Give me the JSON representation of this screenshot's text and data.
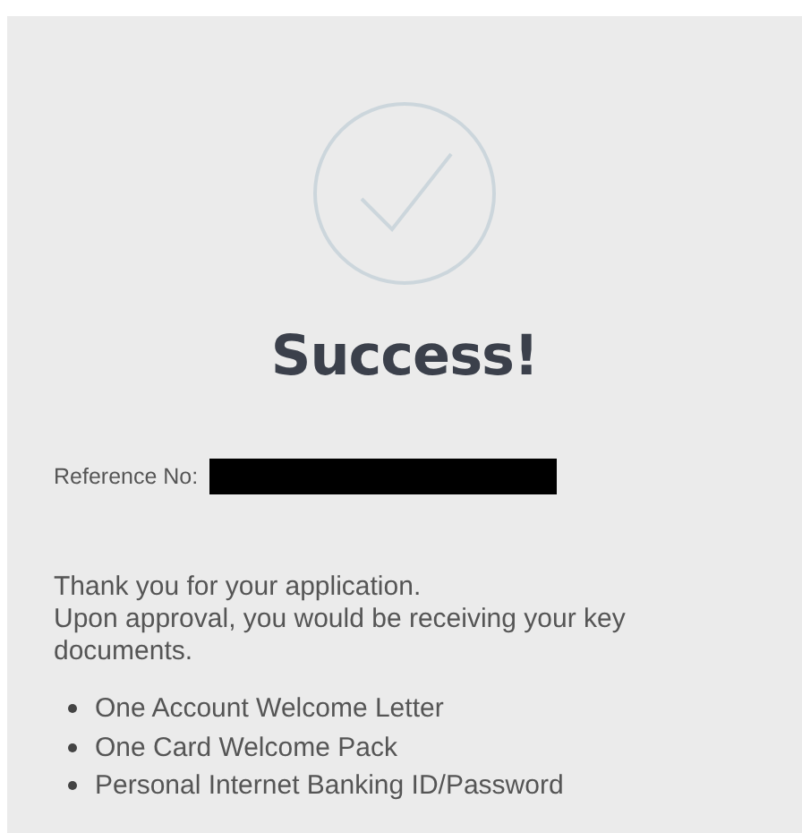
{
  "title": "Success!",
  "reference": {
    "label": "Reference No:",
    "redacted": true
  },
  "paragraphs": [
    "Thank you for your application.",
    "Upon approval, you would be receiving your key documents."
  ],
  "documents": [
    "One Account Welcome Letter",
    "One Card Welcome Pack",
    "Personal Internet Banking ID/Password"
  ]
}
